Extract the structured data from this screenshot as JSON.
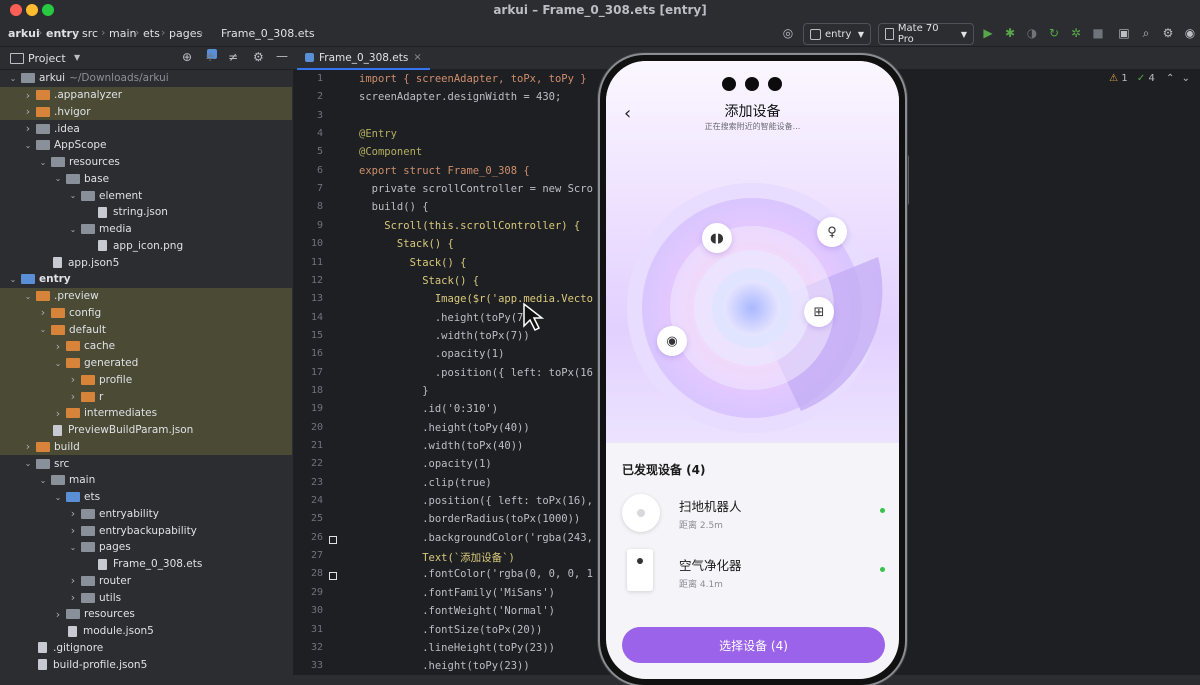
{
  "window": {
    "title": "arkui – Frame_0_308.ets [entry]",
    "traffic_colors": [
      "#ff5f57",
      "#febc2e",
      "#28c840"
    ]
  },
  "breadcrumb": [
    "arkui",
    "entry",
    "src",
    "main",
    "ets",
    "pages",
    "Frame_0_308.ets"
  ],
  "toolbar": {
    "module_select": "entry",
    "device_select": "Mate 70 Pro"
  },
  "project_panel": {
    "title": "Project"
  },
  "tree": [
    {
      "depth": 0,
      "open": true,
      "kind": "folder",
      "label": "arkui",
      "sub": "~/Downloads/arkui"
    },
    {
      "depth": 1,
      "open": false,
      "kind": "folder-orange",
      "label": ".appanalyzer",
      "hl": true
    },
    {
      "depth": 1,
      "open": false,
      "kind": "folder-orange",
      "label": ".hvigor",
      "hl": true
    },
    {
      "depth": 1,
      "open": false,
      "kind": "folder",
      "label": ".idea"
    },
    {
      "depth": 1,
      "open": true,
      "kind": "folder",
      "label": "AppScope"
    },
    {
      "depth": 2,
      "open": true,
      "kind": "folder",
      "label": "resources"
    },
    {
      "depth": 3,
      "open": true,
      "kind": "folder",
      "label": "base"
    },
    {
      "depth": 4,
      "open": true,
      "kind": "folder",
      "label": "element"
    },
    {
      "depth": 5,
      "open": null,
      "kind": "file",
      "label": "string.json"
    },
    {
      "depth": 4,
      "open": true,
      "kind": "folder",
      "label": "media"
    },
    {
      "depth": 5,
      "open": null,
      "kind": "file",
      "label": "app_icon.png"
    },
    {
      "depth": 2,
      "open": null,
      "kind": "file",
      "label": "app.json5"
    },
    {
      "depth": 0,
      "open": true,
      "kind": "folder-blue",
      "label": "entry",
      "bold": true
    },
    {
      "depth": 1,
      "open": true,
      "kind": "folder-orange",
      "label": ".preview",
      "hl": true
    },
    {
      "depth": 2,
      "open": false,
      "kind": "folder-orange",
      "label": "config",
      "hl": true
    },
    {
      "depth": 2,
      "open": true,
      "kind": "folder-orange",
      "label": "default",
      "hl": true
    },
    {
      "depth": 3,
      "open": false,
      "kind": "folder-orange",
      "label": "cache",
      "hl": true
    },
    {
      "depth": 3,
      "open": true,
      "kind": "folder-orange",
      "label": "generated",
      "hl": true
    },
    {
      "depth": 4,
      "open": false,
      "kind": "folder-orange",
      "label": "profile",
      "hl": true
    },
    {
      "depth": 4,
      "open": false,
      "kind": "folder-orange",
      "label": "r",
      "hl": true
    },
    {
      "depth": 3,
      "open": false,
      "kind": "folder-orange",
      "label": "intermediates",
      "hl": true
    },
    {
      "depth": 2,
      "open": null,
      "kind": "file",
      "label": "PreviewBuildParam.json",
      "hl": true
    },
    {
      "depth": 1,
      "open": false,
      "kind": "folder-orange",
      "label": "build",
      "hl": true
    },
    {
      "depth": 1,
      "open": true,
      "kind": "folder",
      "label": "src"
    },
    {
      "depth": 2,
      "open": true,
      "kind": "folder",
      "label": "main"
    },
    {
      "depth": 3,
      "open": true,
      "kind": "folder-blue",
      "label": "ets"
    },
    {
      "depth": 4,
      "open": false,
      "kind": "folder",
      "label": "entryability"
    },
    {
      "depth": 4,
      "open": false,
      "kind": "folder",
      "label": "entrybackupability"
    },
    {
      "depth": 4,
      "open": true,
      "kind": "folder",
      "label": "pages"
    },
    {
      "depth": 5,
      "open": null,
      "kind": "file",
      "label": "Frame_0_308.ets"
    },
    {
      "depth": 4,
      "open": false,
      "kind": "folder",
      "label": "router"
    },
    {
      "depth": 4,
      "open": false,
      "kind": "folder",
      "label": "utils"
    },
    {
      "depth": 3,
      "open": false,
      "kind": "folder",
      "label": "resources"
    },
    {
      "depth": 3,
      "open": null,
      "kind": "file",
      "label": "module.json5"
    },
    {
      "depth": 1,
      "open": null,
      "kind": "file",
      "label": ".gitignore"
    },
    {
      "depth": 1,
      "open": null,
      "kind": "file",
      "label": "build-profile.json5"
    }
  ],
  "editor": {
    "tab_label": "Frame_0_308.ets",
    "inspection": {
      "warnings": "1",
      "ok": "4"
    },
    "lines": [
      {
        "n": "1",
        "t": "import { screenAdapter, toPx, toPy }"
      },
      {
        "n": "2",
        "t": "screenAdapter.designWidth = 430;"
      },
      {
        "n": "3",
        "t": ""
      },
      {
        "n": "4",
        "t": "@Entry"
      },
      {
        "n": "5",
        "t": "@Component"
      },
      {
        "n": "6",
        "t": "export struct Frame_0_308 {"
      },
      {
        "n": "7",
        "t": "  private scrollController = new Scro"
      },
      {
        "n": "8",
        "t": "  build() {"
      },
      {
        "n": "9",
        "t": "    Scroll(this.scrollController) {"
      },
      {
        "n": "10",
        "t": "      Stack() {"
      },
      {
        "n": "11",
        "t": "        Stack() {"
      },
      {
        "n": "12",
        "t": "          Stack() {"
      },
      {
        "n": "13",
        "t": "            Image($r('app.media.Vecto"
      },
      {
        "n": "14",
        "t": "            .height(toPy(7))"
      },
      {
        "n": "15",
        "t": "            .width(toPx(7))"
      },
      {
        "n": "16",
        "t": "            .opacity(1)"
      },
      {
        "n": "17",
        "t": "            .position({ left: toPx(16"
      },
      {
        "n": "18",
        "t": "          }"
      },
      {
        "n": "19",
        "t": "          .id('0:310')"
      },
      {
        "n": "20",
        "t": "          .height(toPy(40))"
      },
      {
        "n": "21",
        "t": "          .width(toPx(40))"
      },
      {
        "n": "22",
        "t": "          .opacity(1)"
      },
      {
        "n": "23",
        "t": "          .clip(true)"
      },
      {
        "n": "24",
        "t": "          .position({ left: toPx(16),"
      },
      {
        "n": "25",
        "t": "          .borderRadius(toPx(1000))"
      },
      {
        "n": "26",
        "t": "          .backgroundColor('rgba(243,"
      },
      {
        "n": "27",
        "t": "          Text(`添加设备`)"
      },
      {
        "n": "28",
        "t": "          .fontColor('rgba(0, 0, 0, 1"
      },
      {
        "n": "29",
        "t": "          .fontFamily('MiSans')"
      },
      {
        "n": "30",
        "t": "          .fontWeight('Normal')"
      },
      {
        "n": "31",
        "t": "          .fontSize(toPx(20))"
      },
      {
        "n": "32",
        "t": "          .lineHeight(toPy(23))"
      },
      {
        "n": "33",
        "t": "          .height(toPy(23))"
      }
    ]
  },
  "phone": {
    "title": "添加设备",
    "subtitle": "正在搜索附近的智能设备...",
    "found_heading": "已发现设备 (4)",
    "devices": [
      {
        "name": "扫地机器人",
        "distance": "距离 2.5m"
      },
      {
        "name": "空气净化器",
        "distance": "距离 4.1m"
      }
    ],
    "radar_icons": [
      "earbuds-icon",
      "lightbulb-icon",
      "router-icon",
      "camera-icon"
    ],
    "cta": "选择设备 (4)",
    "accent": "#9a63ea",
    "status_color": "#39c24a"
  }
}
